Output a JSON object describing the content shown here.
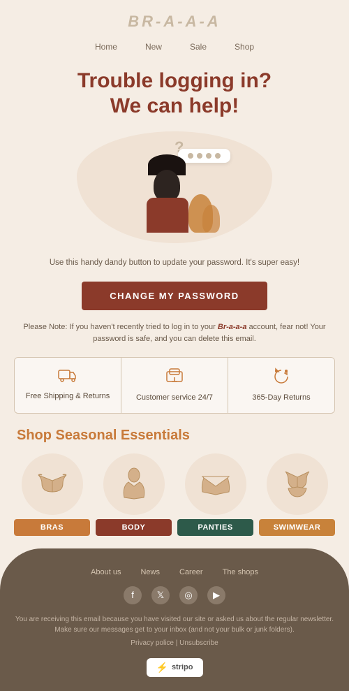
{
  "brand": {
    "logo": "BR-A-A-A",
    "tagline": ""
  },
  "nav": {
    "items": [
      "Home",
      "New",
      "Sale",
      "Shop"
    ]
  },
  "hero": {
    "title_line1": "Trouble logging in?",
    "title_line2": "We can help!"
  },
  "body_text": "Use this handy dandy button to update your password. It's super easy!",
  "cta_button": "CHANGE MY PASSWORD",
  "note_text": "Please Note: If you haven't recently tried to log in to your Br-a-a-a account, fear not! Your password is safe, and you can delete this email.",
  "features": [
    {
      "icon": "🚚",
      "text": "Free Shipping & Returns"
    },
    {
      "icon": "🖥",
      "text": "Customer service 24/7"
    },
    {
      "icon": "🎧",
      "text": "365-Day Returns"
    }
  ],
  "shop_section": {
    "title": "Shop Seasonal Essentials",
    "products": [
      {
        "icon": "👙",
        "label": "BRAS",
        "color_class": "label-bras"
      },
      {
        "icon": "👗",
        "label": "BODY",
        "color_class": "label-body"
      },
      {
        "icon": "👙",
        "label": "PANTIES",
        "color_class": "label-panties"
      },
      {
        "icon": "👙",
        "label": "SWIMWEAR",
        "color_class": "label-swimwear"
      }
    ]
  },
  "footer": {
    "nav_items": [
      "About us",
      "News",
      "Career",
      "The shops"
    ],
    "social": [
      "f",
      "t",
      "ig",
      "yt"
    ],
    "body_text": "You are receiving this email because you have visited our site or asked us about the regular newsletter. Make sure our messages get to your inbox (and not your bulk or junk folders).",
    "links": "Privacy police | Unsubscribe",
    "badge_text": "stripo"
  },
  "colors": {
    "primary_red": "#8b3a2a",
    "accent_orange": "#c87a3a",
    "bg_cream": "#f5ede4",
    "footer_brown": "#6a5a4a"
  }
}
